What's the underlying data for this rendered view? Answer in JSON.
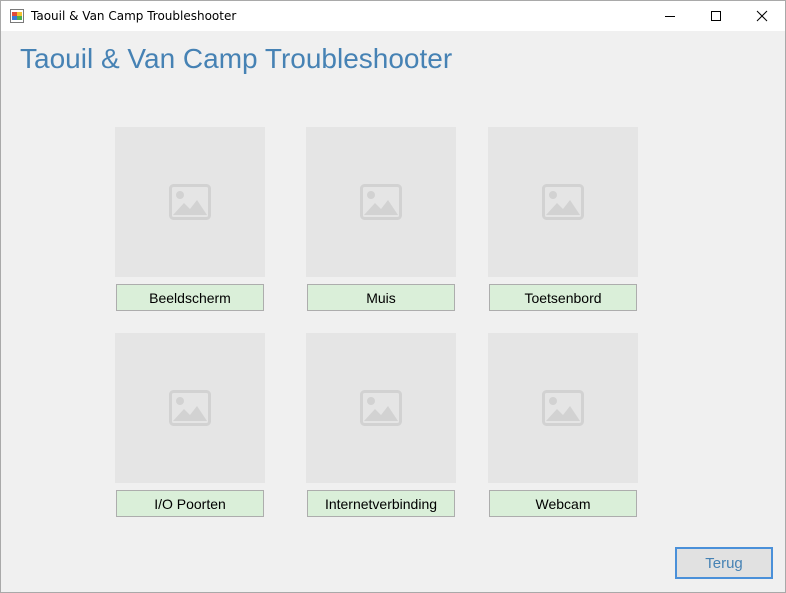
{
  "window": {
    "title": "Taouil & Van Camp Troubleshooter",
    "app_icon": "winforms-app-icon",
    "controls": [
      "minimize-icon",
      "maximize-icon",
      "close-icon"
    ]
  },
  "main": {
    "heading": "Taouil & Van Camp Troubleshooter",
    "categories": [
      {
        "label": "Beeldscherm",
        "image_icon": "image-placeholder-icon"
      },
      {
        "label": "Muis",
        "image_icon": "image-placeholder-icon"
      },
      {
        "label": "Toetsenbord",
        "image_icon": "image-placeholder-icon"
      },
      {
        "label": "I/O Poorten",
        "image_icon": "image-placeholder-icon"
      },
      {
        "label": "Internetverbinding",
        "image_icon": "image-placeholder-icon"
      },
      {
        "label": "Webcam",
        "image_icon": "image-placeholder-icon"
      }
    ],
    "back_button": "Terug"
  },
  "colors": {
    "heading": "#4682b4",
    "category_button_bg": "#daefd9",
    "form_bg": "#f0f0f0",
    "tile_bg": "#e5e5e5",
    "back_button_border": "#4a90d9"
  }
}
